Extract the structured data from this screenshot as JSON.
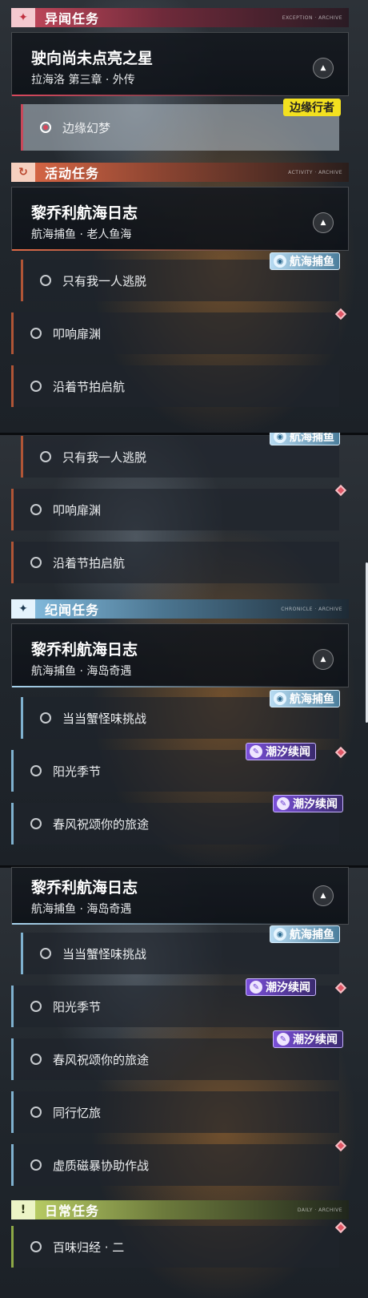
{
  "panel1": {
    "cat_anomaly": {
      "name": "异闻任务",
      "tiny": "EXCEPTION · ARCHIVE"
    },
    "quest_star": {
      "title": "驶向尚未点亮之星",
      "sub": "拉海洛 第三章 · 外传",
      "tag": "边缘行者"
    },
    "item_dream": "边缘幻梦",
    "cat_event": {
      "name": "活动任务",
      "tiny": "ACTIVITY · ARCHIVE"
    },
    "quest_log": {
      "title": "黎乔利航海日志",
      "sub": "航海捕鱼 · 老人鱼海"
    },
    "items": [
      "只有我一人逃脱",
      "叩响扉渊",
      "沿着节拍启航"
    ],
    "tag_fishing": "航海捕鱼"
  },
  "panel2": {
    "items": [
      "只有我一人逃脱",
      "叩响扉渊",
      "沿着节拍启航"
    ],
    "tag_fishing": "航海捕鱼",
    "cat_chronicle": {
      "name": "纪闻任务",
      "tiny": "CHRONICLE · ARCHIVE"
    },
    "quest_log": {
      "title": "黎乔利航海日志",
      "sub": "航海捕鱼 · 海岛奇遇"
    },
    "items2": [
      "当当蟹怪味挑战",
      "阳光季节",
      "春风祝颂你的旅途"
    ],
    "tag_fishing2": "航海捕鱼",
    "tag_tide1": "潮汐续闻",
    "tag_tide2": "潮汐续闻"
  },
  "panel3": {
    "quest_log": {
      "title": "黎乔利航海日志",
      "sub": "航海捕鱼 · 海岛奇遇"
    },
    "items": [
      "当当蟹怪味挑战",
      "阳光季节",
      "春风祝颂你的旅途",
      "同行忆旅",
      "虚质磁暴协助作战"
    ],
    "tag_fishing": "航海捕鱼",
    "tag_tide1": "潮汐续闻",
    "tag_tide2": "潮汐续闻",
    "cat_daily": {
      "name": "日常任务",
      "tiny": "DAILY · ARCHIVE"
    },
    "daily_item": "百味归经 · 二"
  },
  "icons": {
    "collapse": "chevron-up-icon",
    "radio": "radio-icon",
    "gem": "diamond-marker-icon"
  },
  "colors": {
    "anomaly": "#c94a5e",
    "event": "#e06a47",
    "chronicle": "#8ac4e8",
    "daily": "#c4d96a",
    "edge_tag": "#f3e11f",
    "tide_tag": "#7a4fd8"
  }
}
